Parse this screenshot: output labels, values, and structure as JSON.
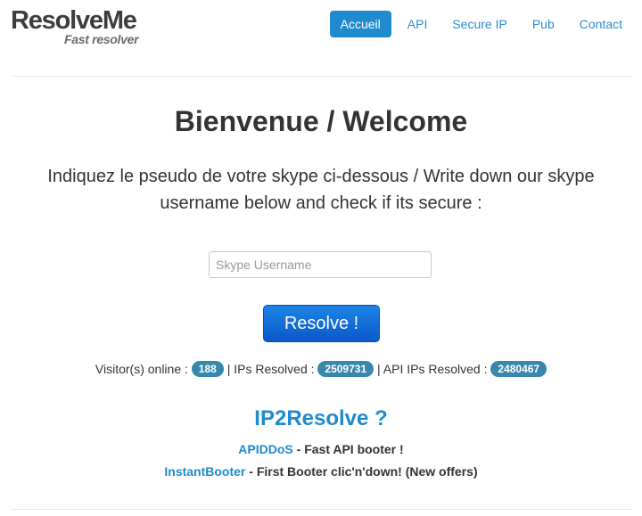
{
  "logo": {
    "name": "ResolveMe",
    "tagline": "Fast resolver"
  },
  "nav": {
    "items": [
      {
        "label": "Accueil"
      },
      {
        "label": "API"
      },
      {
        "label": "Secure IP"
      },
      {
        "label": "Pub"
      },
      {
        "label": "Contact"
      }
    ]
  },
  "main": {
    "title": "Bienvenue / Welcome",
    "lead_line1": "Indiquez le pseudo de votre skype ci-dessous / Write down our skype",
    "lead_line2": "username below and check if its secure :",
    "search": {
      "placeholder": "Skype Username",
      "value": ""
    },
    "resolve_label": "Resolve !"
  },
  "stats": {
    "visitors_label": "Visitor(s) online :",
    "visitors_count": "188",
    "sep1": "|",
    "ips_label": "IPs Resolved :",
    "ips_count": "2509731",
    "sep2": "|",
    "api_label": "API IPs Resolved :",
    "api_count": "2480467"
  },
  "promo": {
    "heading": "IP2Resolve ?",
    "items": [
      {
        "link": "APIDDoS",
        "text": "- Fast API booter !"
      },
      {
        "link": "InstantBooter",
        "text": "- First Booter clic'n'down! (New offers)"
      }
    ]
  },
  "colors": {
    "accent": "#1f8bce",
    "badge": "#3a87ad",
    "button": "#0a58c9"
  }
}
